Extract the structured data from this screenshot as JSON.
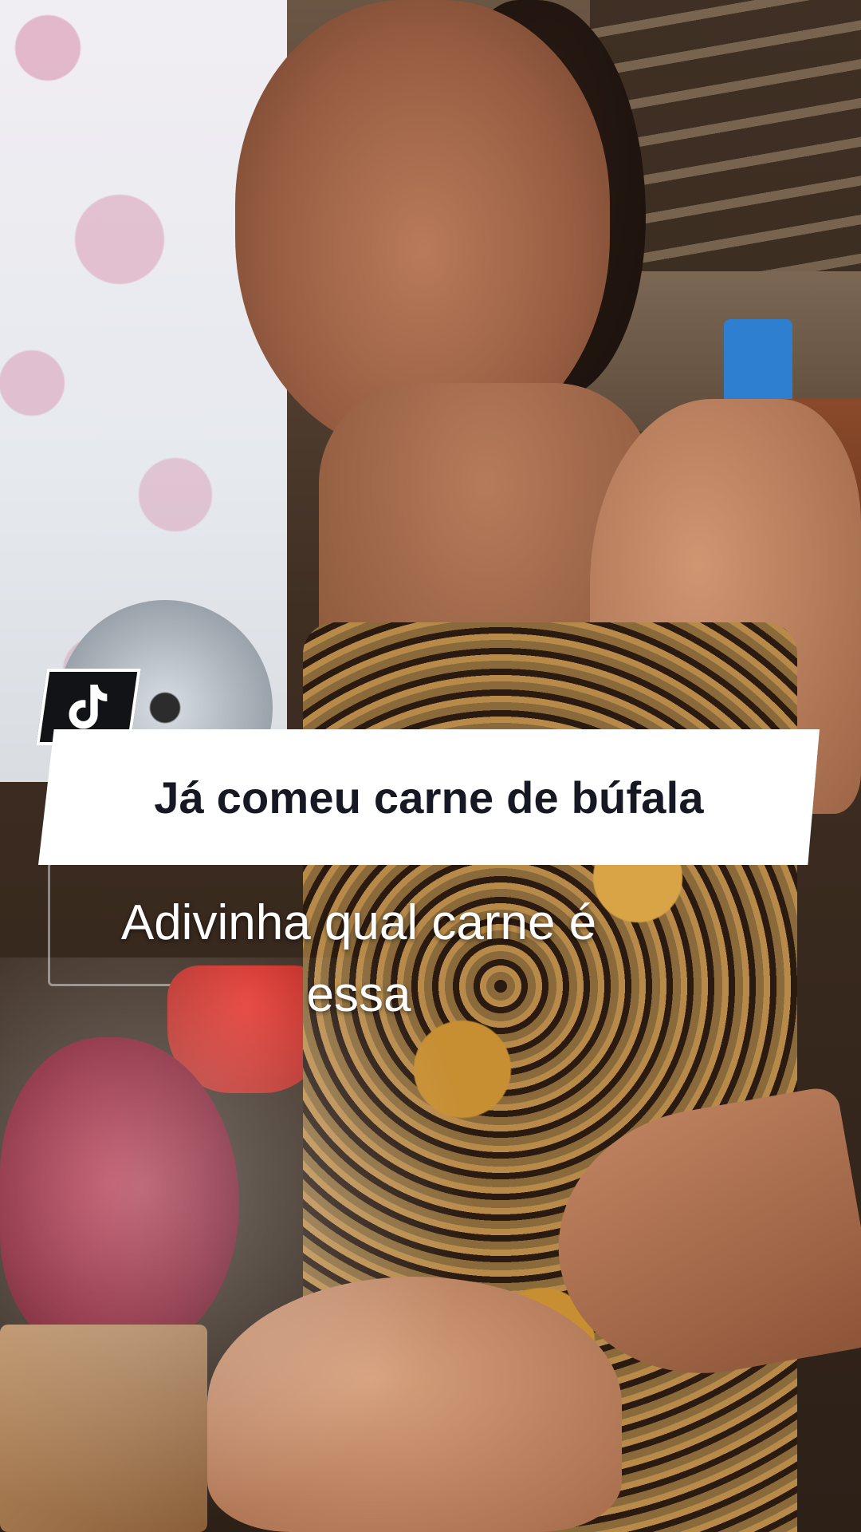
{
  "app": {
    "logo_icon": "tiktok-logo-icon"
  },
  "overlay": {
    "title_caption": "Já comeu carne de búfala",
    "subtitle_line1": "Adivinha qual carne é",
    "subtitle_line2": "essa"
  },
  "colors": {
    "caption_background": "#ffffff",
    "caption_text": "#161823",
    "subtitle_text": "#ffffff",
    "logo_background": "#111316"
  }
}
